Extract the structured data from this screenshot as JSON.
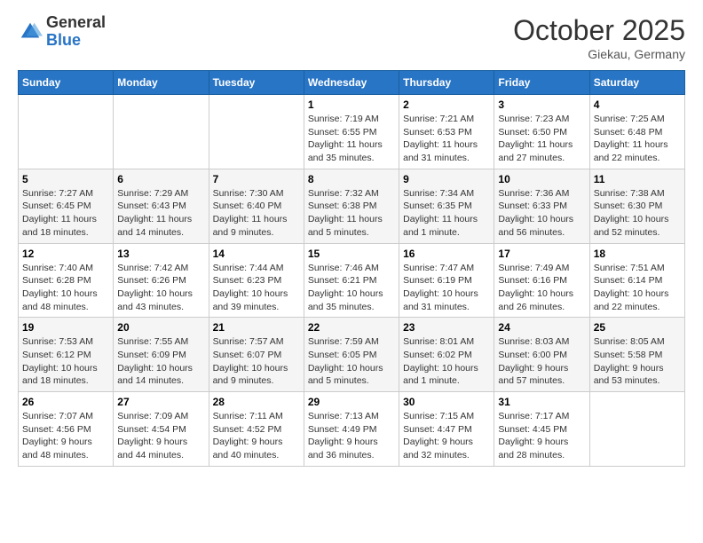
{
  "logo": {
    "general": "General",
    "blue": "Blue"
  },
  "header": {
    "month": "October 2025",
    "location": "Giekau, Germany"
  },
  "weekdays": [
    "Sunday",
    "Monday",
    "Tuesday",
    "Wednesday",
    "Thursday",
    "Friday",
    "Saturday"
  ],
  "weeks": [
    [
      {
        "day": "",
        "info": ""
      },
      {
        "day": "",
        "info": ""
      },
      {
        "day": "",
        "info": ""
      },
      {
        "day": "1",
        "info": "Sunrise: 7:19 AM\nSunset: 6:55 PM\nDaylight: 11 hours and 35 minutes."
      },
      {
        "day": "2",
        "info": "Sunrise: 7:21 AM\nSunset: 6:53 PM\nDaylight: 11 hours and 31 minutes."
      },
      {
        "day": "3",
        "info": "Sunrise: 7:23 AM\nSunset: 6:50 PM\nDaylight: 11 hours and 27 minutes."
      },
      {
        "day": "4",
        "info": "Sunrise: 7:25 AM\nSunset: 6:48 PM\nDaylight: 11 hours and 22 minutes."
      }
    ],
    [
      {
        "day": "5",
        "info": "Sunrise: 7:27 AM\nSunset: 6:45 PM\nDaylight: 11 hours and 18 minutes."
      },
      {
        "day": "6",
        "info": "Sunrise: 7:29 AM\nSunset: 6:43 PM\nDaylight: 11 hours and 14 minutes."
      },
      {
        "day": "7",
        "info": "Sunrise: 7:30 AM\nSunset: 6:40 PM\nDaylight: 11 hours and 9 minutes."
      },
      {
        "day": "8",
        "info": "Sunrise: 7:32 AM\nSunset: 6:38 PM\nDaylight: 11 hours and 5 minutes."
      },
      {
        "day": "9",
        "info": "Sunrise: 7:34 AM\nSunset: 6:35 PM\nDaylight: 11 hours and 1 minute."
      },
      {
        "day": "10",
        "info": "Sunrise: 7:36 AM\nSunset: 6:33 PM\nDaylight: 10 hours and 56 minutes."
      },
      {
        "day": "11",
        "info": "Sunrise: 7:38 AM\nSunset: 6:30 PM\nDaylight: 10 hours and 52 minutes."
      }
    ],
    [
      {
        "day": "12",
        "info": "Sunrise: 7:40 AM\nSunset: 6:28 PM\nDaylight: 10 hours and 48 minutes."
      },
      {
        "day": "13",
        "info": "Sunrise: 7:42 AM\nSunset: 6:26 PM\nDaylight: 10 hours and 43 minutes."
      },
      {
        "day": "14",
        "info": "Sunrise: 7:44 AM\nSunset: 6:23 PM\nDaylight: 10 hours and 39 minutes."
      },
      {
        "day": "15",
        "info": "Sunrise: 7:46 AM\nSunset: 6:21 PM\nDaylight: 10 hours and 35 minutes."
      },
      {
        "day": "16",
        "info": "Sunrise: 7:47 AM\nSunset: 6:19 PM\nDaylight: 10 hours and 31 minutes."
      },
      {
        "day": "17",
        "info": "Sunrise: 7:49 AM\nSunset: 6:16 PM\nDaylight: 10 hours and 26 minutes."
      },
      {
        "day": "18",
        "info": "Sunrise: 7:51 AM\nSunset: 6:14 PM\nDaylight: 10 hours and 22 minutes."
      }
    ],
    [
      {
        "day": "19",
        "info": "Sunrise: 7:53 AM\nSunset: 6:12 PM\nDaylight: 10 hours and 18 minutes."
      },
      {
        "day": "20",
        "info": "Sunrise: 7:55 AM\nSunset: 6:09 PM\nDaylight: 10 hours and 14 minutes."
      },
      {
        "day": "21",
        "info": "Sunrise: 7:57 AM\nSunset: 6:07 PM\nDaylight: 10 hours and 9 minutes."
      },
      {
        "day": "22",
        "info": "Sunrise: 7:59 AM\nSunset: 6:05 PM\nDaylight: 10 hours and 5 minutes."
      },
      {
        "day": "23",
        "info": "Sunrise: 8:01 AM\nSunset: 6:02 PM\nDaylight: 10 hours and 1 minute."
      },
      {
        "day": "24",
        "info": "Sunrise: 8:03 AM\nSunset: 6:00 PM\nDaylight: 9 hours and 57 minutes."
      },
      {
        "day": "25",
        "info": "Sunrise: 8:05 AM\nSunset: 5:58 PM\nDaylight: 9 hours and 53 minutes."
      }
    ],
    [
      {
        "day": "26",
        "info": "Sunrise: 7:07 AM\nSunset: 4:56 PM\nDaylight: 9 hours and 48 minutes."
      },
      {
        "day": "27",
        "info": "Sunrise: 7:09 AM\nSunset: 4:54 PM\nDaylight: 9 hours and 44 minutes."
      },
      {
        "day": "28",
        "info": "Sunrise: 7:11 AM\nSunset: 4:52 PM\nDaylight: 9 hours and 40 minutes."
      },
      {
        "day": "29",
        "info": "Sunrise: 7:13 AM\nSunset: 4:49 PM\nDaylight: 9 hours and 36 minutes."
      },
      {
        "day": "30",
        "info": "Sunrise: 7:15 AM\nSunset: 4:47 PM\nDaylight: 9 hours and 32 minutes."
      },
      {
        "day": "31",
        "info": "Sunrise: 7:17 AM\nSunset: 4:45 PM\nDaylight: 9 hours and 28 minutes."
      },
      {
        "day": "",
        "info": ""
      }
    ]
  ]
}
